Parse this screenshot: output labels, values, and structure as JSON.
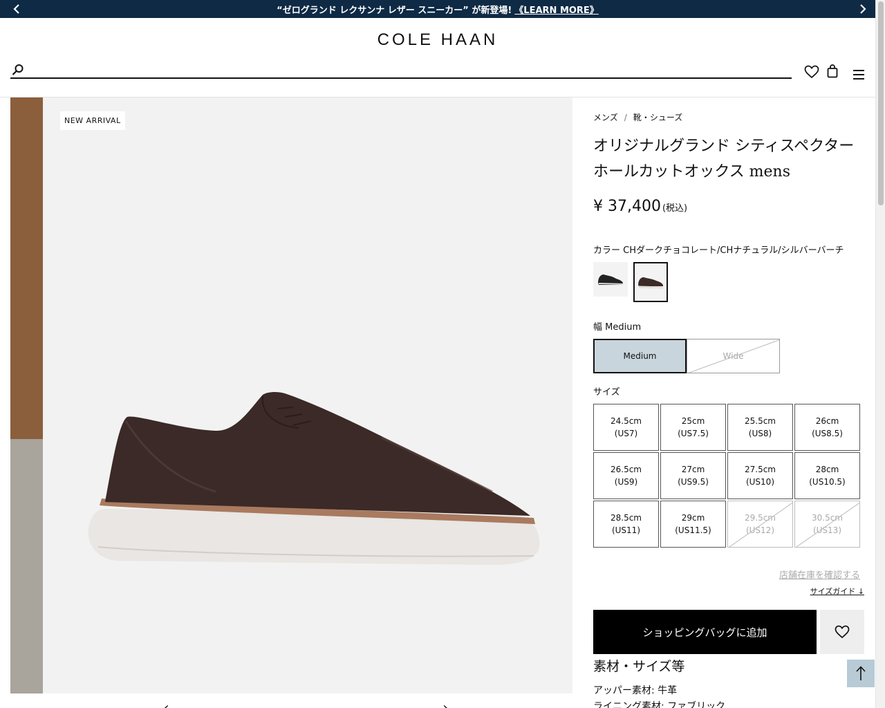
{
  "promo": {
    "text": "“ゼログランド レクサンナ レザー スニーカー” が新登場!",
    "link": "《LEARN MORE》"
  },
  "brand": {
    "logo": "COLE HAAN"
  },
  "search": {
    "placeholder": ""
  },
  "gallery": {
    "badge": "NEW ARRIVAL"
  },
  "breadcrumb": [
    "メンズ",
    "/",
    "靴・シューズ"
  ],
  "product": {
    "title": "オリジナルグランド シティスペクター ホールカットオックス mens",
    "price": "¥ 37,400",
    "tax_note": "(税込)",
    "color_label": "カラー CHダークチョコレート/CHナチュラル/シルバーバーチ",
    "width_label": "幅 Medium",
    "widths": [
      {
        "label": "Medium",
        "state": "selected"
      },
      {
        "label": "Wide",
        "state": "disabled"
      }
    ],
    "size_label": "サイズ",
    "sizes": [
      {
        "cm": "24.5cm",
        "us": "(US7)",
        "available": true
      },
      {
        "cm": "25cm",
        "us": "(US7.5)",
        "available": true
      },
      {
        "cm": "25.5cm",
        "us": "(US8)",
        "available": true
      },
      {
        "cm": "26cm",
        "us": "(US8.5)",
        "available": true
      },
      {
        "cm": "26.5cm",
        "us": "(US9)",
        "available": true
      },
      {
        "cm": "27cm",
        "us": "(US9.5)",
        "available": true
      },
      {
        "cm": "27.5cm",
        "us": "(US10)",
        "available": true
      },
      {
        "cm": "28cm",
        "us": "(US10.5)",
        "available": true
      },
      {
        "cm": "28.5cm",
        "us": "(US11)",
        "available": true
      },
      {
        "cm": "29cm",
        "us": "(US11.5)",
        "available": true
      },
      {
        "cm": "29.5cm",
        "us": "(US12)",
        "available": false
      },
      {
        "cm": "30.5cm",
        "us": "(US13)",
        "available": false
      }
    ],
    "store_stock_link": "店舗在庫を確認する",
    "size_guide_link": "サイズガイド ↓",
    "add_to_bag": "ショッピングバッグに追加",
    "spec_title": "素材・サイズ等",
    "specs": [
      "アッパー素材: 牛革",
      "ライニング素材: ファブリック"
    ]
  },
  "colors": {
    "promo_bg": "#0e2a45",
    "width_selected_bg": "#c9d5dc",
    "to_top_bg": "#b7cad6"
  }
}
